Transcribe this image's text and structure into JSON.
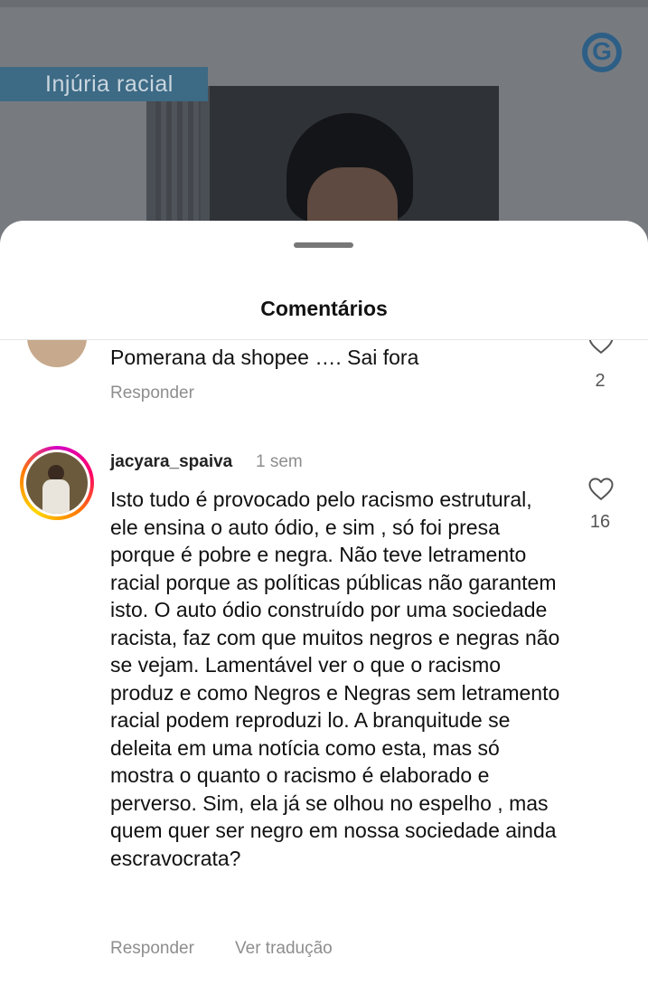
{
  "post": {
    "tag_label": "Injúria racial",
    "logo_letter": "G"
  },
  "sheet": {
    "title": "Comentários"
  },
  "comments": [
    {
      "text": "Pomerana da shopee …. Sai fora",
      "reply_label": "Responder",
      "likes": "2"
    },
    {
      "username": "jacyara_spaiva",
      "time": "1 sem",
      "text": "Isto tudo é provocado pelo racismo estrutural, ele ensina o auto ódio, e sim , só foi presa porque é pobre e negra. Não teve letramento racial porque as políticas públicas não garantem isto. O auto ódio construído por uma sociedade racista, faz com que muitos negros e negras não se vejam. Lamentável ver o que o racismo produz e como Negros e Negras sem letramento racial podem reproduzi lo. A branquitude se deleita em uma notícia como esta, mas só mostra o quanto o racismo é elaborado e perverso. Sim, ela já se olhou no espelho , mas quem quer ser negro em nossa sociedade ainda escravocrata?",
      "reply_label": "Responder",
      "translate_label": "Ver tradução",
      "likes": "16"
    }
  ],
  "icons": {
    "like": "heart-icon",
    "logo": "globo-logo-icon"
  },
  "colors": {
    "tag_bg": "#3d6a85",
    "logo": "#2d5f86",
    "muted_text": "#8e8e8e"
  }
}
